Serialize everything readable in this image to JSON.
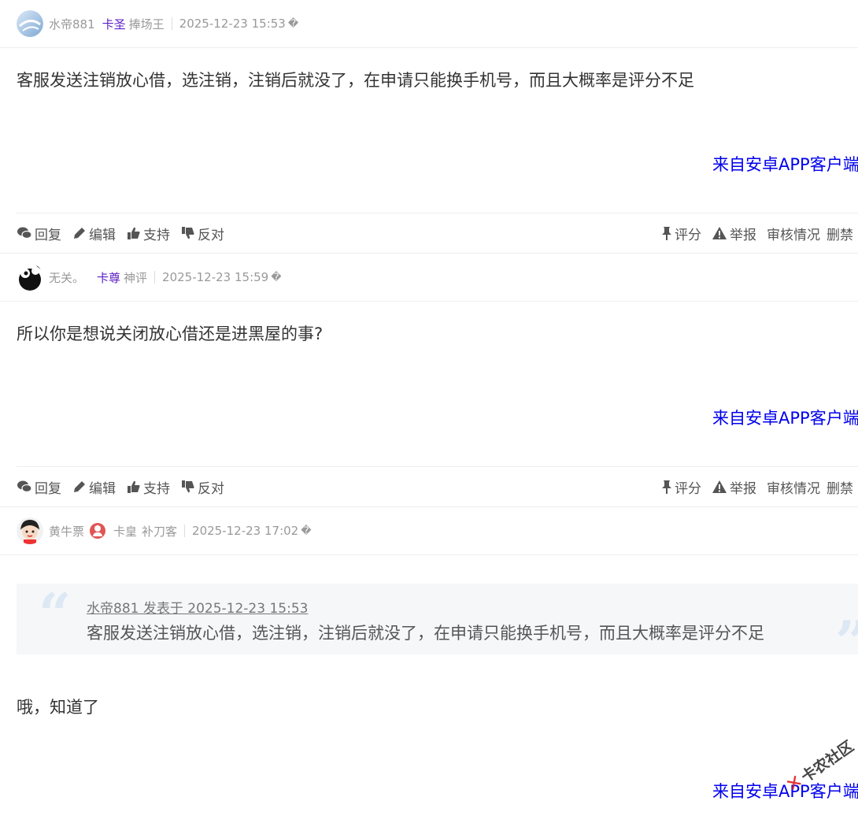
{
  "posts": [
    {
      "author": "水帝881",
      "level": "卡圣",
      "title": "捧场王",
      "time": "2025-12-23 15:53",
      "time_suffix": "�",
      "content": "客服发送注销放心借，选注销，注销后就没了，在申请只能换手机号，而且大概率是评分不足",
      "from": "来自安卓APP客户端"
    },
    {
      "author": "无关。",
      "level": "卡尊",
      "title": "神评",
      "time": "2025-12-23 15:59",
      "time_suffix": "�",
      "content": "所以你是想说关闭放心借还是进黑屋的事?",
      "from": "来自安卓APP客户端"
    },
    {
      "author": "黄牛票",
      "level": "卡皇",
      "title": "补刀客",
      "time": "2025-12-23 17:02",
      "time_suffix": "�",
      "quote_meta": "水帝881 发表于 2025-12-23 15:53",
      "quote_text": "客服发送注销放心借，选注销，注销后就没了，在申请只能换手机号，而且大概率是评分不足",
      "content": "哦，知道了",
      "from": "来自安卓APP客户端"
    }
  ],
  "actions": {
    "reply": "回复",
    "edit": "编辑",
    "support": "支持",
    "oppose": "反对",
    "rate": "评分",
    "report": "举报",
    "audit": "审核情况",
    "ban": "删禁"
  },
  "watermark": "卡农社区"
}
